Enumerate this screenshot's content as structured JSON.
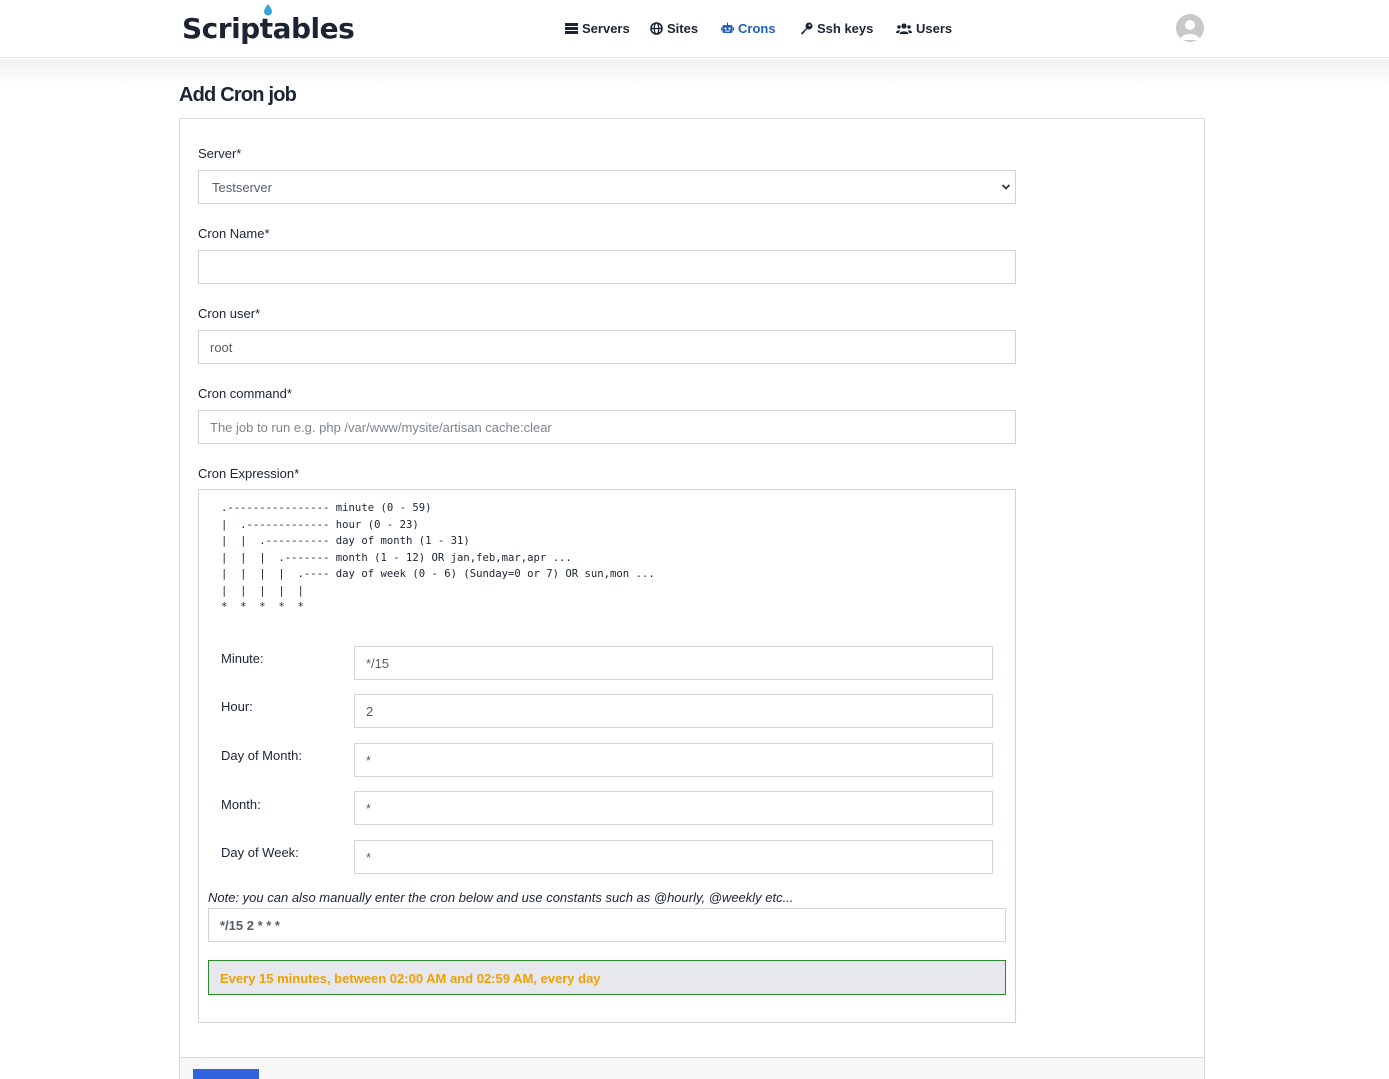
{
  "brand": {
    "name": "Scriptables",
    "accent": "#1f5fbf",
    "logo_drop_color": "#3aa0d8"
  },
  "nav": {
    "items": [
      {
        "label": "Servers",
        "icon": "server-icon"
      },
      {
        "label": "Sites",
        "icon": "globe-icon"
      },
      {
        "label": "Crons",
        "icon": "robot-icon",
        "active": true
      },
      {
        "label": "Ssh keys",
        "icon": "key-icon"
      },
      {
        "label": "Users",
        "icon": "users-icon"
      }
    ],
    "avatar": "user-avatar-icon"
  },
  "page": {
    "title": "Add Cron job"
  },
  "form": {
    "server": {
      "label": "Server*",
      "selected": "Testserver"
    },
    "cron_name": {
      "label": "Cron Name*",
      "value": ""
    },
    "cron_user": {
      "label": "Cron user*",
      "value": "root"
    },
    "cron_command": {
      "label": "Cron command*",
      "placeholder": "The job to run e.g. php /var/www/mysite/artisan cache:clear",
      "value": ""
    },
    "expression": {
      "label": "Cron Expression*",
      "ascii_help": ".---------------- minute (0 - 59)\n|  .------------- hour (0 - 23)\n|  |  .---------- day of month (1 - 31)\n|  |  |  .------- month (1 - 12) OR jan,feb,mar,apr ...\n|  |  |  |  .---- day of week (0 - 6) (Sunday=0 or 7) OR sun,mon ...\n|  |  |  |  |\n*  *  *  *  *",
      "fields": [
        {
          "label": "Minute:",
          "value": "*/15"
        },
        {
          "label": "Hour:",
          "value": "2"
        },
        {
          "label": "Day of Month:",
          "value": "*"
        },
        {
          "label": "Month:",
          "value": "*"
        },
        {
          "label": "Day of Week:",
          "value": "*"
        }
      ],
      "note": "Note: you can also manually enter the cron below and use constants such as @hourly, @weekly etc...",
      "manual_value": "*/15 2 * * *",
      "human_readable": "Every 15 minutes, between 02:00 AM and 02:59 AM, every day"
    }
  }
}
